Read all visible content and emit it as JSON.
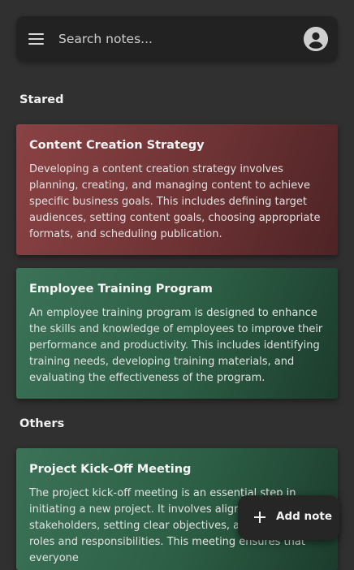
{
  "search": {
    "placeholder": "Search notes..."
  },
  "icons": {
    "menu": "hamburger-menu",
    "account": "account-circle",
    "add": "plus"
  },
  "colors": {
    "background": "#303030",
    "search_bar": "#222222",
    "starred_card": "#7a3a3c",
    "other_card": "#2e5e46"
  },
  "sections": {
    "starred": {
      "label": "Stared",
      "notes": [
        {
          "title": "Content Creation Strategy",
          "body": "Developing a content creation strategy involves planning, creating, and managing content to achieve specific business goals. This includes defining target audiences, setting content goals, choosing appropriate formats, and scheduling publication.",
          "color": "red"
        },
        {
          "title": "Employee Training Program",
          "body": "An employee training program is designed to enhance the skills and knowledge of employees to improve their performance and productivity. This includes identifying training needs, developing training materials, and evaluating the effectiveness of the program.",
          "color": "green"
        }
      ]
    },
    "others": {
      "label": "Others",
      "notes": [
        {
          "title": "Project Kick-Off Meeting",
          "body": "The project kick-off meeting is an essential step in initiating a new project. It involves aligning stakeholders, setting clear objectives, and defining roles and responsibilities. This meeting ensures that everyone",
          "color": "green"
        }
      ]
    }
  },
  "fab": {
    "label": "Add note"
  }
}
